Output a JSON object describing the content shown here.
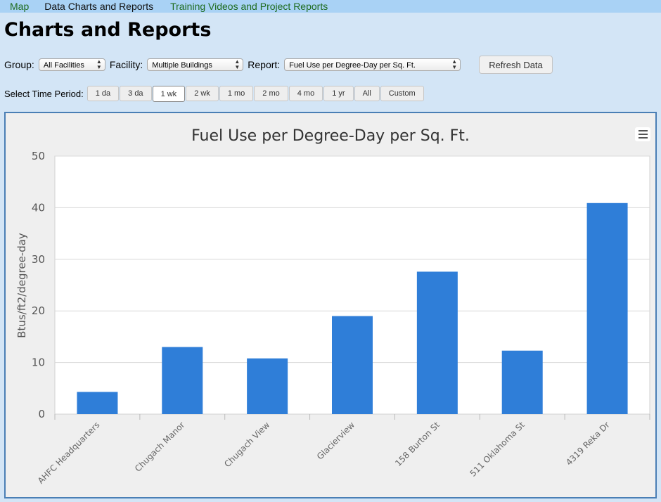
{
  "nav": {
    "items": [
      "Map",
      "Data Charts and Reports",
      "Training Videos and Project Reports"
    ]
  },
  "page": {
    "title": "Charts and Reports"
  },
  "controls": {
    "group_label": "Group:",
    "group_value": "All Facilities",
    "facility_label": "Facility:",
    "facility_value": "Multiple Buildings",
    "report_label": "Report:",
    "report_value": "Fuel Use per Degree-Day per Sq. Ft.",
    "refresh_label": "Refresh Data"
  },
  "period": {
    "label": "Select Time Period:",
    "options": [
      "1 da",
      "3 da",
      "1 wk",
      "2 wk",
      "1 mo",
      "2 mo",
      "4 mo",
      "1 yr",
      "All",
      "Custom"
    ],
    "selected": "1 wk"
  },
  "colors": {
    "bar": "#2f7ed8",
    "nav_bg": "#a9d2f5",
    "page_bg": "#d3e5f6",
    "chart_border": "#4a7fb5"
  },
  "chart_data": {
    "type": "bar",
    "title": "Fuel Use per Degree-Day per Sq. Ft.",
    "xlabel": "",
    "ylabel": "Btus/ft2/degree-day",
    "categories": [
      "AHFC Headquarters",
      "Chugach Manor",
      "Chugach View",
      "Glacierview",
      "158 Burton St",
      "511 Oklahoma St",
      "4319 Reka Dr"
    ],
    "values": [
      4.3,
      13.0,
      10.8,
      19.0,
      27.6,
      12.3,
      40.9
    ],
    "ylim": [
      0,
      50
    ],
    "yticks": [
      0,
      10,
      20,
      30,
      40,
      50
    ],
    "grid": true,
    "legend": "none"
  }
}
